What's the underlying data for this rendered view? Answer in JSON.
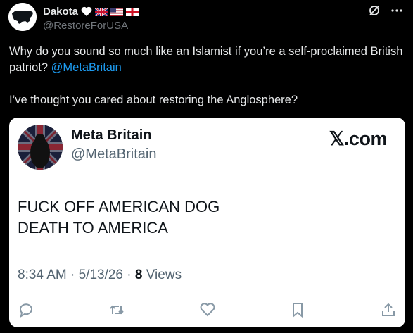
{
  "author": {
    "name": "Dakota",
    "handle": "@RestoreForUSA"
  },
  "tweet": {
    "line1": "Why do you sound so much like an Islamist if you’re a self-proclaimed British patriot? ",
    "mention": "@MetaBritain",
    "line2": "I’ve thought you cared about restoring the Anglosphere?"
  },
  "card": {
    "name": "Meta Britain",
    "handle": "@MetaBritain",
    "brand": "𝕏.com",
    "body_line1": "FUCK OFF AMERICAN DOG",
    "body_line2": "DEATH TO AMERICA",
    "time": "8:34 AM · 5/13/26 · ",
    "views_count": "8",
    "views_label": " Views"
  },
  "icons": [
    "map-usa-icon",
    "heart-icon",
    "uk-flag-icon",
    "us-flag-icon",
    "england-flag-icon",
    "grok-icon",
    "more-icon",
    "reply-icon",
    "retweet-icon",
    "like-icon",
    "bookmark-icon",
    "share-icon"
  ],
  "colors": {
    "mention": "#1d9bf0",
    "background": "#000000",
    "card": "#ffffff"
  }
}
